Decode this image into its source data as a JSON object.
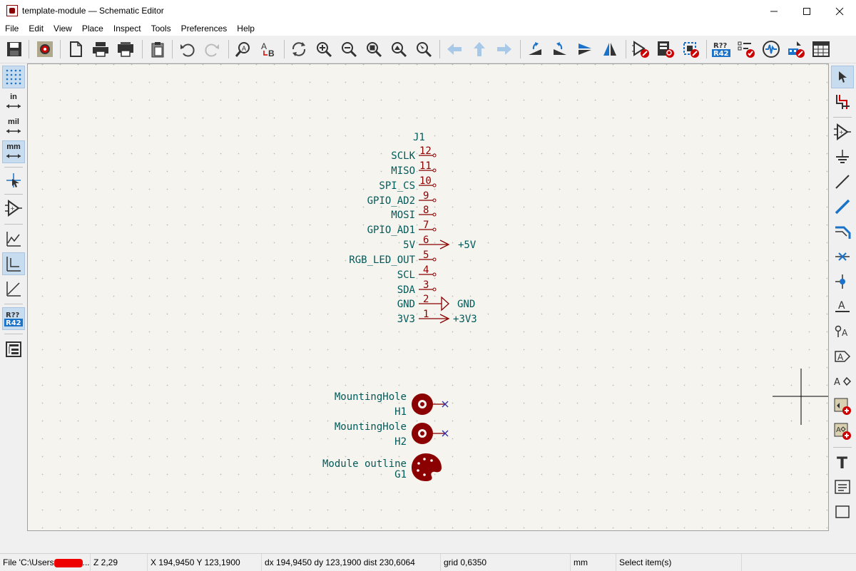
{
  "window": {
    "title": "template-module — Schematic Editor",
    "minimize_icon": "minimize-icon",
    "maximize_icon": "maximize-icon",
    "close_icon": "close-icon"
  },
  "menu": [
    "File",
    "Edit",
    "View",
    "Place",
    "Inspect",
    "Tools",
    "Preferences",
    "Help"
  ],
  "left_toolbar": {
    "in_label": "in",
    "mil_label": "mil",
    "mm_label": "mm",
    "annotate_badge": [
      "R??",
      "R42"
    ]
  },
  "right_toolbar": {
    "text_tool_label": "T",
    "label_tool": "A"
  },
  "top_toolbar": {
    "annotate_badge": [
      "R??",
      "R42"
    ]
  },
  "schematic": {
    "connector": {
      "reference": "J1",
      "pins": [
        {
          "name": "SCLK",
          "number": "12"
        },
        {
          "name": "MISO",
          "number": "11"
        },
        {
          "name": "SPI_CS",
          "number": "10"
        },
        {
          "name": "GPIO_AD2",
          "number": "9"
        },
        {
          "name": "MOSI",
          "number": "8"
        },
        {
          "name": "GPIO_AD1",
          "number": "7"
        },
        {
          "name": "5V",
          "number": "6"
        },
        {
          "name": "RGB_LED_OUT",
          "number": "5"
        },
        {
          "name": "SCL",
          "number": "4"
        },
        {
          "name": "SDA",
          "number": "3"
        },
        {
          "name": "GND",
          "number": "2"
        },
        {
          "name": "3V3",
          "number": "1"
        }
      ]
    },
    "power_symbols": {
      "plus5v": "+5V",
      "gnd": "GND",
      "plus3v3": "+3V3"
    },
    "mounting_holes": [
      {
        "value": "MountingHole",
        "reference": "H1"
      },
      {
        "value": "MountingHole",
        "reference": "H2"
      }
    ],
    "graphic": {
      "value": "Module outline",
      "reference": "G1"
    }
  },
  "status": {
    "file_prefix": "File 'C:\\Users",
    "file_suffix": "...",
    "zoom": "Z 2,29",
    "coords": "X 194,9450  Y 123,1900",
    "delta": "dx 194,9450  dy 123,1900  dist 230,6064",
    "grid": "grid 0,6350",
    "units": "mm",
    "mode": "Select item(s)"
  },
  "colors": {
    "accent": "#1a73c8",
    "schematic_text": "#005a5a",
    "pin": "#8b0000",
    "canvas": "#f5f4ef"
  }
}
